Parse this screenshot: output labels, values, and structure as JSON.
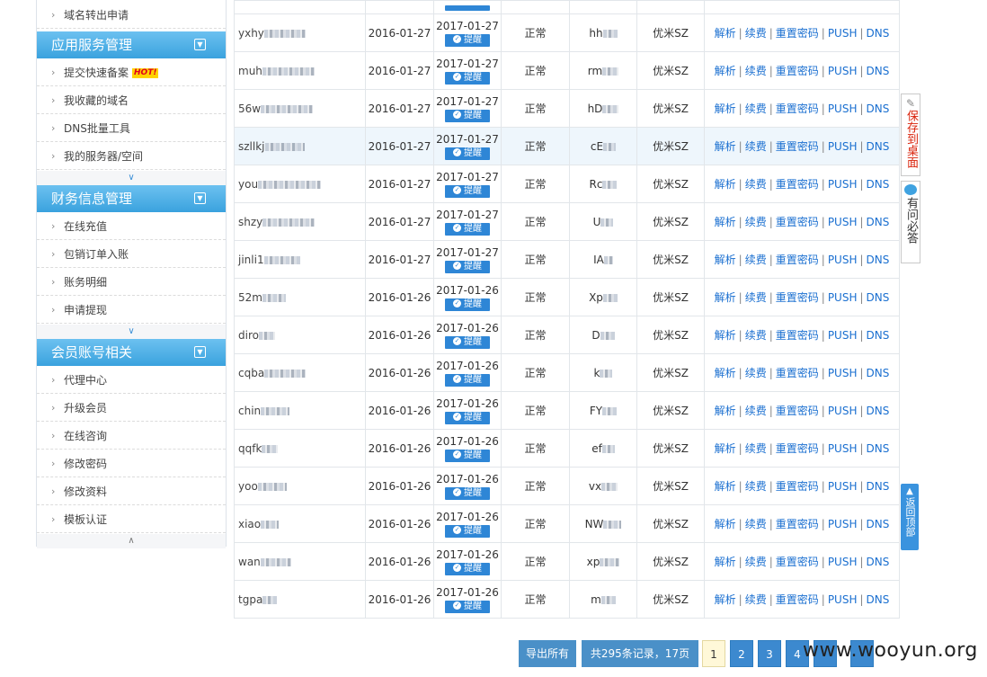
{
  "sidebar": {
    "top_item": "域名转出申请",
    "sections": [
      {
        "title": "应用服务管理",
        "items": [
          "提交快速备案",
          "我收藏的域名",
          "DNS批量工具",
          "我的服务器/空间"
        ],
        "hot_badge": "HOT!"
      },
      {
        "title": "财务信息管理",
        "items": [
          "在线充值",
          "包销订单入账",
          "账务明细",
          "申请提现"
        ]
      },
      {
        "title": "会员账号相关",
        "items": [
          "代理中心",
          "升级会员",
          "在线咨询",
          "修改密码",
          "修改资料",
          "模板认证"
        ]
      }
    ]
  },
  "table": {
    "remind_label": "提醒",
    "ops": [
      "解析",
      "续费",
      "重置密码",
      "PUSH",
      "DNS"
    ],
    "rows": [
      {
        "name": "yxhy",
        "reg": "2016-01-27",
        "exp": "2017-01-27",
        "status": "正常",
        "tpl": "hh",
        "registrar": "优米SZ"
      },
      {
        "name": "muh",
        "reg": "2016-01-27",
        "exp": "2017-01-27",
        "status": "正常",
        "tpl": "rm",
        "registrar": "优米SZ"
      },
      {
        "name": "56w",
        "reg": "2016-01-27",
        "exp": "2017-01-27",
        "status": "正常",
        "tpl": "hD",
        "registrar": "优米SZ"
      },
      {
        "name": "szllkj",
        "reg": "2016-01-27",
        "exp": "2017-01-27",
        "status": "正常",
        "tpl": "cE",
        "registrar": "优米SZ"
      },
      {
        "name": "you",
        "reg": "2016-01-27",
        "exp": "2017-01-27",
        "status": "正常",
        "tpl": "Rc",
        "registrar": "优米SZ"
      },
      {
        "name": "shzy",
        "reg": "2016-01-27",
        "exp": "2017-01-27",
        "status": "正常",
        "tpl": "U",
        "registrar": "优米SZ"
      },
      {
        "name": "jinli1",
        "reg": "2016-01-27",
        "exp": "2017-01-27",
        "status": "正常",
        "tpl": "IA",
        "registrar": "优米SZ"
      },
      {
        "name": "52m",
        "reg": "2016-01-26",
        "exp": "2017-01-26",
        "status": "正常",
        "tpl": "Xp",
        "registrar": "优米SZ"
      },
      {
        "name": "diro",
        "reg": "2016-01-26",
        "exp": "2017-01-26",
        "status": "正常",
        "tpl": "D",
        "registrar": "优米SZ"
      },
      {
        "name": "cqba",
        "reg": "2016-01-26",
        "exp": "2017-01-26",
        "status": "正常",
        "tpl": "k",
        "registrar": "优米SZ"
      },
      {
        "name": "chin",
        "reg": "2016-01-26",
        "exp": "2017-01-26",
        "status": "正常",
        "tpl": "FY",
        "registrar": "优米SZ"
      },
      {
        "name": "qqfk",
        "reg": "2016-01-26",
        "exp": "2017-01-26",
        "status": "正常",
        "tpl": "ef",
        "registrar": "优米SZ"
      },
      {
        "name": "yoo",
        "reg": "2016-01-26",
        "exp": "2017-01-26",
        "status": "正常",
        "tpl": "vx",
        "registrar": "优米SZ"
      },
      {
        "name": "xiao",
        "reg": "2016-01-26",
        "exp": "2017-01-26",
        "status": "正常",
        "tpl": "NW",
        "registrar": "优米SZ"
      },
      {
        "name": "wan",
        "reg": "2016-01-26",
        "exp": "2017-01-26",
        "status": "正常",
        "tpl": "xp",
        "registrar": "优米SZ"
      },
      {
        "name": "tgpa",
        "reg": "2016-01-26",
        "exp": "2017-01-26",
        "status": "正常",
        "tpl": "m",
        "registrar": "优米SZ"
      }
    ]
  },
  "pager": {
    "export_label": "导出所有",
    "summary": "共295条记录，17页",
    "pages": [
      "1",
      "2",
      "3",
      "4",
      "",
      ""
    ],
    "current": "1"
  },
  "float": {
    "save_desktop": "保存到桌面",
    "faq": "有问必答",
    "back_top": "返回顶部"
  },
  "watermark": "www.wooyun.org",
  "colors": {
    "header_blue": "#3aa2de",
    "link_blue": "#1a6fd0",
    "button_blue": "#4a90c8",
    "highlight_row": "#eef6fc"
  }
}
